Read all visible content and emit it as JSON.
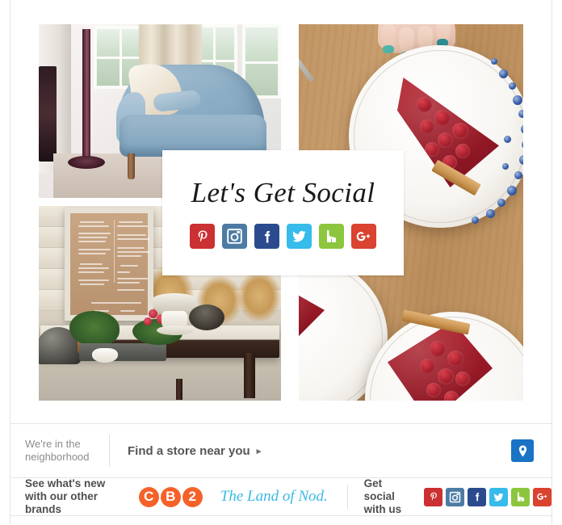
{
  "collage": {
    "photos": [
      {
        "id": "armchair",
        "alt": "Light blue upholstered armchair by sunny windows with cream curtains"
      },
      {
        "id": "table",
        "alt": "Rustic console table with chalkboard menu, greens, bowls and cloche"
      },
      {
        "id": "tart",
        "alt": "Hand reaching for raspberry tart slices on blue dotted plates on a wood table"
      }
    ]
  },
  "social_card": {
    "title": "Let's Get Social",
    "icons": [
      {
        "name": "pinterest-icon",
        "label": "Pinterest",
        "color": "#cb3032"
      },
      {
        "name": "instagram-icon",
        "label": "Instagram",
        "color": "#4d7ba3"
      },
      {
        "name": "facebook-icon",
        "label": "Facebook",
        "color": "#2c4b8e"
      },
      {
        "name": "twitter-icon",
        "label": "Twitter",
        "color": "#37bbeb"
      },
      {
        "name": "houzz-icon",
        "label": "Houzz",
        "color": "#8cc63e"
      },
      {
        "name": "googleplus-icon",
        "label": "Google Plus",
        "color": "#d9432f"
      }
    ]
  },
  "store_bar": {
    "label_line1": "We're in the",
    "label_line2": "neighborhood",
    "find_store_label": "Find a store near you",
    "find_store_arrow": "▸",
    "pin_button_name": "map-pin-button",
    "pin_button_color": "#1a73c4"
  },
  "brands_bar": {
    "label_line1": "See what's new",
    "label_line2": "with our other brands",
    "cb2": {
      "letters": [
        "C",
        "B",
        "2"
      ],
      "color": "#f4622a"
    },
    "land_of_nod": {
      "text": "The Land of Nod.",
      "color": "#3cb9e3"
    },
    "get_social_line1": "Get social",
    "get_social_line2": "with us",
    "icons": [
      {
        "name": "pinterest-icon",
        "label": "Pinterest",
        "color": "#cb3032"
      },
      {
        "name": "instagram-icon",
        "label": "Instagram",
        "color": "#4d7ba3"
      },
      {
        "name": "facebook-icon",
        "label": "Facebook",
        "color": "#2c4b8e"
      },
      {
        "name": "twitter-icon",
        "label": "Twitter",
        "color": "#37bbeb"
      },
      {
        "name": "houzz-icon",
        "label": "Houzz",
        "color": "#8cc63e"
      },
      {
        "name": "googleplus-icon",
        "label": "Google Plus",
        "color": "#d9432f"
      }
    ]
  }
}
